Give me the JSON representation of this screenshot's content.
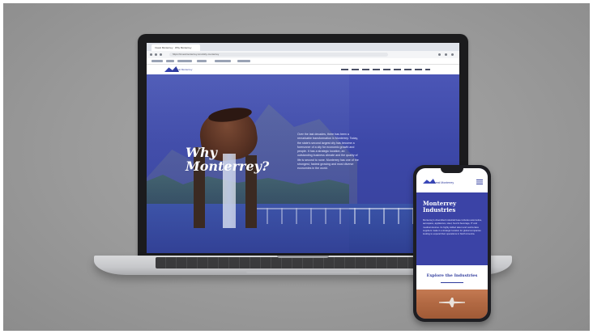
{
  "laptop": {
    "browser": {
      "tab_title": "Invest Monterrey · Why Monterrey",
      "url": "https://investmonterrey.com/why-monterrey"
    },
    "site": {
      "logo_text": "Invest Monterrey",
      "hero_title": "Why Monterrey?",
      "hero_body": "Over the last decades, there has been a remarkable transformation in Monterrey. Today, the state's second largest city has become a forerunner of a city for economic growth and people. It has a strategic location, an outstanding business climate and the quality of life is second to none. Monterrey has one of the strongest, fastest growing and most diverse economies in the world."
    }
  },
  "phone": {
    "logo_text": "Invest Monterrey",
    "title": "Monterrey Industries",
    "body": "Monterrey's diversified industrial base includes automotive, aerospace, appliances, steel, food & beverage, IT and medical devices. Its highly skilled talent and world-class suppliers make it a strategic location for global companies looking to expand their operations in North America.",
    "cta": "Explore the Industries"
  },
  "colors": {
    "brand_blue": "#3b43a6",
    "background_gray": "#9a9a9a",
    "device_dark": "#1b1b1d"
  }
}
